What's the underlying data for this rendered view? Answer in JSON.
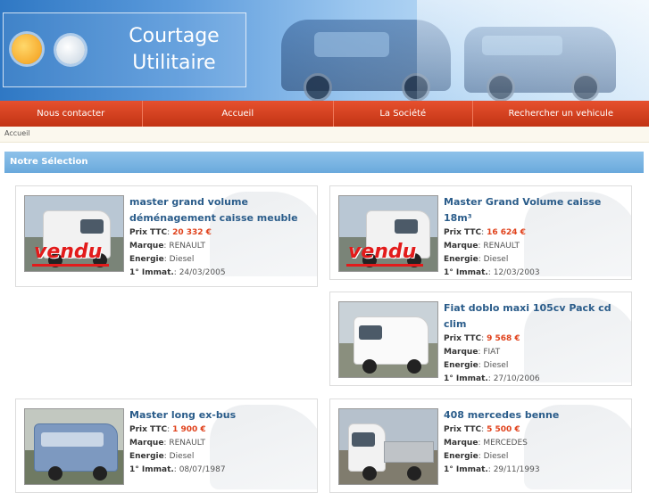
{
  "header": {
    "title_line1": "Courtage",
    "title_line2": "Utilitaire"
  },
  "nav": {
    "items": [
      {
        "label": "Nous contacter"
      },
      {
        "label": "Accueil"
      },
      {
        "label": "La Société"
      },
      {
        "label": "Rechercher un vehicule"
      }
    ]
  },
  "breadcrumb": "Accueil",
  "section_title": "Notre Sélection",
  "labels": {
    "price": "Prix TTC",
    "brand": "Marque",
    "energy": "Energie",
    "first_reg": "1° Immat."
  },
  "sold_badge": "vendu",
  "listings": [
    {
      "title_line1": "master grand volume",
      "title_line2": "déménagement caisse meuble",
      "price": "20 332 €",
      "brand": "RENAULT",
      "energy": "Diesel",
      "first_reg": "24/03/2005",
      "sold": true
    },
    {
      "title_line1": "Master Grand Volume caisse 18m³",
      "title_line2": "",
      "price": "16 624 €",
      "brand": "RENAULT",
      "energy": "Diesel",
      "first_reg": "12/03/2003",
      "sold": true
    },
    {
      "title_line1": "Fiat doblo maxi 105cv Pack cd clim",
      "title_line2": "",
      "price": "9 568 €",
      "brand": "FIAT",
      "energy": "Diesel",
      "first_reg": "27/10/2006",
      "sold": false
    },
    {
      "title_line1": "Master long ex-bus",
      "title_line2": "",
      "price": "1 900 €",
      "brand": "RENAULT",
      "energy": "Diesel",
      "first_reg": "08/07/1987",
      "sold": false
    },
    {
      "title_line1": "408 mercedes benne",
      "title_line2": "",
      "price": "5 500 €",
      "brand": "MERCEDES",
      "energy": "Diesel",
      "first_reg": "29/11/1993",
      "sold": false
    }
  ],
  "colors": {
    "nav_bg": "#d4401f",
    "section_bg": "#7ab4e2",
    "title_blue": "#2a5c8a",
    "price_red": "#e0421c"
  }
}
